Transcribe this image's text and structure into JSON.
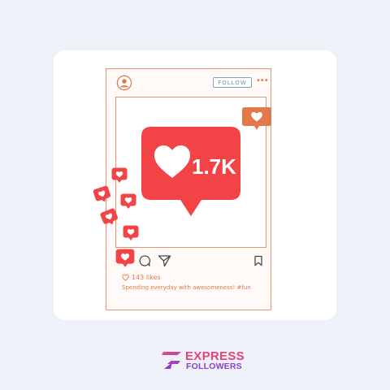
{
  "post": {
    "follow_label": "FOLLOW",
    "like_count_badge": "1.7K",
    "likes_text": "143 likes",
    "caption": "Spending everyday with awesomeness! #fun"
  },
  "brand": {
    "line1": "EXPRESS",
    "line2": "FOLLOWERS"
  },
  "icons": [
    "user-avatar-icon",
    "more-dots-icon",
    "heart-icon",
    "comment-icon",
    "share-icon",
    "bookmark-icon"
  ],
  "colors": {
    "like_red": "#f24446",
    "notification_orange": "#e07a4a",
    "frame_outline": "#e8956f",
    "follow_teal": "#6a97a6",
    "brand_pink": "#e8407a",
    "brand_purple": "#8b3fd0",
    "background": "#eef2f8"
  }
}
